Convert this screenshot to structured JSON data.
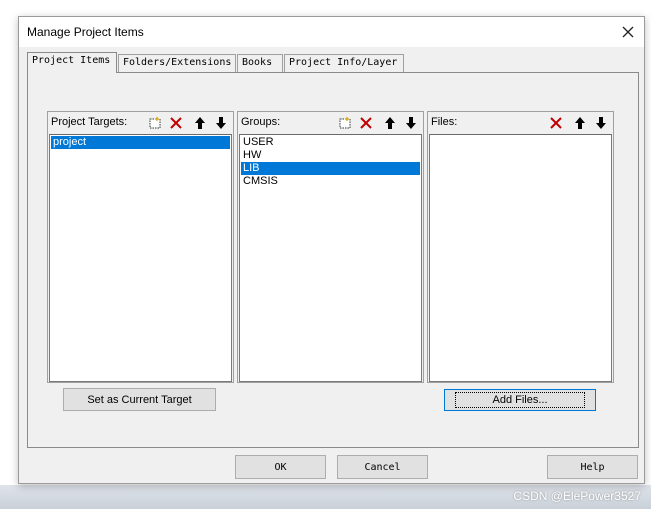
{
  "dialog": {
    "title": "Manage Project Items",
    "close_glyph": "✕"
  },
  "tabs": [
    {
      "label": "Project Items",
      "active": true
    },
    {
      "label": "Folders/Extensions",
      "active": false
    },
    {
      "label": "Books",
      "active": false
    },
    {
      "label": "Project Info/Layer",
      "active": false
    }
  ],
  "targets": {
    "label": "Project Targets:",
    "items": [
      {
        "text": "project",
        "selected": true
      }
    ]
  },
  "groups": {
    "label": "Groups:",
    "items": [
      {
        "text": "USER",
        "selected": false
      },
      {
        "text": "HW",
        "selected": false
      },
      {
        "text": "LIB",
        "selected": true
      },
      {
        "text": "CMSIS",
        "selected": false
      }
    ]
  },
  "files": {
    "label": "Files:",
    "items": []
  },
  "buttons": {
    "set_current_target": "Set as Current Target",
    "add_files": "Add Files...",
    "ok": "OK",
    "cancel": "Cancel",
    "help": "Help"
  },
  "watermark": "CSDN @ElePower3527",
  "icons": {
    "new": "new-item-icon",
    "delete": "delete-icon",
    "move_up": "move-up-icon",
    "move_down": "move-down-icon"
  },
  "colors": {
    "selection": "#0078d7",
    "delete_red": "#c00000",
    "dialog_bg": "#f0f0f0"
  }
}
